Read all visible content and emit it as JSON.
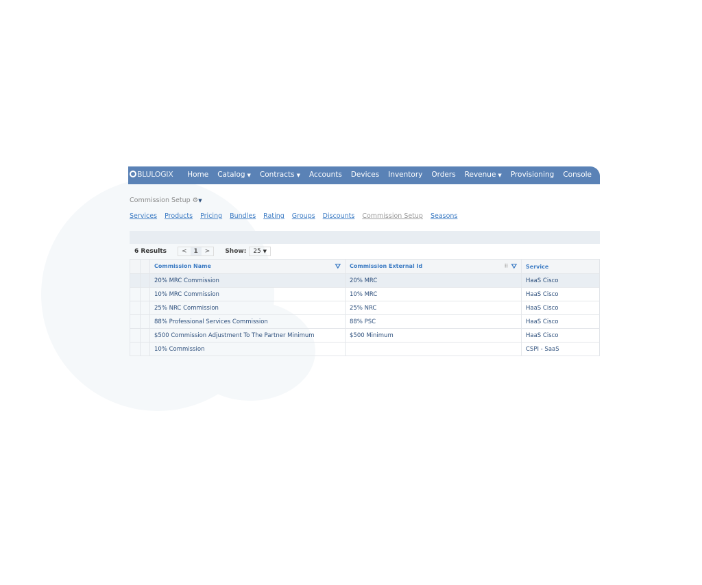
{
  "brand": "BLULOGIX",
  "nav": [
    {
      "label": "Home"
    },
    {
      "label": "Catalog",
      "dropdown": true
    },
    {
      "label": "Contracts",
      "dropdown": true
    },
    {
      "label": "Accounts"
    },
    {
      "label": "Devices"
    },
    {
      "label": "Inventory"
    },
    {
      "label": "Orders"
    },
    {
      "label": "Revenue",
      "dropdown": true
    },
    {
      "label": "Provisioning"
    },
    {
      "label": "Console"
    }
  ],
  "breadcrumb": "Commission Setup",
  "subnav": [
    {
      "label": "Services"
    },
    {
      "label": "Products"
    },
    {
      "label": "Pricing"
    },
    {
      "label": "Bundles"
    },
    {
      "label": "Rating"
    },
    {
      "label": "Groups"
    },
    {
      "label": "Discounts"
    },
    {
      "label": "Commission Setup",
      "current": true
    },
    {
      "label": "Seasons"
    }
  ],
  "results": {
    "count": "6 Results",
    "prev": "<",
    "page": "1",
    "next": ">",
    "show_label": "Show:",
    "show_value": "25"
  },
  "table": {
    "headers": [
      "Commission Name",
      "Commission External Id",
      "Service"
    ],
    "rows": [
      [
        "20% MRC Commission",
        "20% MRC",
        "HaaS Cisco"
      ],
      [
        "10% MRC Commission",
        "10% MRC",
        "HaaS Cisco"
      ],
      [
        "25% NRC Commission",
        "25% NRC",
        "HaaS Cisco"
      ],
      [
        "88% Professional Services Commission",
        "88% PSC",
        "HaaS Cisco"
      ],
      [
        "$500 Commission Adjustment To The Partner Minimum",
        "$500 Minimum",
        "HaaS Cisco"
      ],
      [
        "10% Commission",
        "",
        "CSPI - SaaS"
      ]
    ]
  }
}
